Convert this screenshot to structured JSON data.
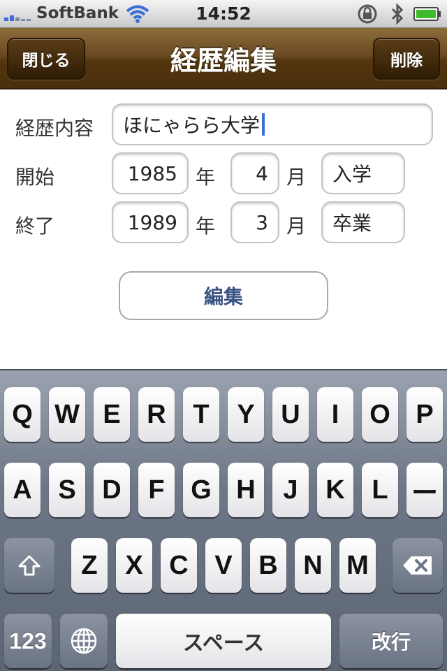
{
  "status_bar": {
    "carrier": "SoftBank",
    "time": "14:52",
    "icons": [
      "signal-icon",
      "wifi-icon",
      "rotation-lock-icon",
      "bluetooth-icon",
      "battery-icon"
    ]
  },
  "nav": {
    "title": "経歴編集",
    "close_label": "閉じる",
    "delete_label": "削除"
  },
  "form": {
    "content_label": "経歴内容",
    "content_value": "ほにゃらら大学",
    "start_label": "開始",
    "start_year": "1985",
    "start_month": "4",
    "start_note": "入学",
    "end_label": "終了",
    "end_year": "1989",
    "end_month": "3",
    "end_note": "卒業",
    "year_unit": "年",
    "month_unit": "月",
    "edit_button": "編集"
  },
  "keyboard": {
    "row1": [
      "Q",
      "W",
      "E",
      "R",
      "T",
      "Y",
      "U",
      "I",
      "O",
      "P"
    ],
    "row2": [
      "A",
      "S",
      "D",
      "F",
      "G",
      "H",
      "J",
      "K",
      "L",
      "ー"
    ],
    "row3": [
      "Z",
      "X",
      "C",
      "V",
      "B",
      "N",
      "M"
    ],
    "numbers_key": "123",
    "space_key": "スペース",
    "return_key": "改行"
  },
  "colors": {
    "nav_brown": "#6a4a22",
    "edit_button_text": "#3a5383",
    "cursor": "#3b6fd6"
  }
}
